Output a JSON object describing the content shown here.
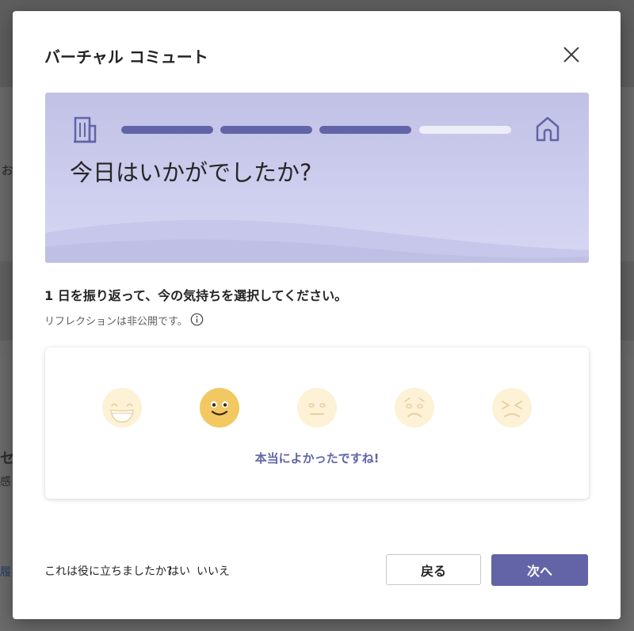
{
  "dialog": {
    "title": "バーチャル コミュート",
    "close_icon": "close-icon"
  },
  "banner": {
    "heading": "今日はいかがでしたか?",
    "left_icon": "building-icon",
    "right_icon": "home-icon",
    "progress": {
      "steps_total": 4,
      "steps_completed": 3
    },
    "colors": {
      "progress_filled": "#6264a7",
      "progress_empty": "#ededf8"
    }
  },
  "prompt": "1 日を振り返って、今の気持ちを選択してください。",
  "privacy_note": "リフレクションは非公開です。",
  "moods": {
    "options": [
      {
        "name": "very-happy",
        "icon": "grinning-face-icon",
        "selected": false
      },
      {
        "name": "happy",
        "icon": "smiling-face-icon",
        "selected": true
      },
      {
        "name": "neutral",
        "icon": "neutral-face-icon",
        "selected": false
      },
      {
        "name": "sad",
        "icon": "sad-face-icon",
        "selected": false
      },
      {
        "name": "frustrated",
        "icon": "frustrated-face-icon",
        "selected": false
      }
    ],
    "selected_label": "本当によかったですね!"
  },
  "footer": {
    "feedback_question": "これは役に立ちましたか?",
    "yes": "はい",
    "no": "いいえ",
    "back_button": "戻る",
    "next_button": "次へ"
  },
  "colors": {
    "accent": "#6264a7",
    "emoji_selected": "#f2c862",
    "emoji_dim": "#fdf1d6"
  },
  "background_app": {
    "fragments": [
      "ぉ",
      "セ",
      "感し",
      "履"
    ]
  }
}
